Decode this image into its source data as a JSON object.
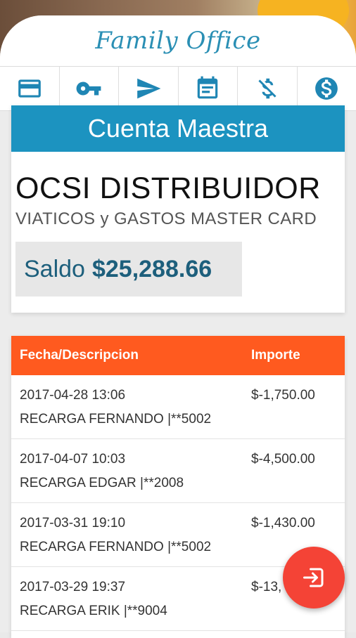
{
  "app": {
    "brand": "Family Office"
  },
  "tabs": [
    {
      "icon": "credit-card-icon",
      "active": false
    },
    {
      "icon": "key-icon",
      "active": true
    },
    {
      "icon": "send-icon",
      "active": false
    },
    {
      "icon": "calendar-icon",
      "active": false
    },
    {
      "icon": "dollar-off-icon",
      "active": false
    },
    {
      "icon": "dollar-circle-icon",
      "active": false
    }
  ],
  "account": {
    "header": "Cuenta Maestra",
    "company": "OCSI DISTRIBUIDOR",
    "description": "VIATICOS y GASTOS MASTER CARD",
    "balance_label": "Saldo",
    "balance_amount": "$25,288.66"
  },
  "transactions": {
    "headers": {
      "date_desc": "Fecha/Descripcion",
      "amount": "Importe"
    },
    "rows": [
      {
        "date": "2017-04-28 13:06",
        "description": "RECARGA FERNANDO |**5002",
        "amount": "$-1,750.00"
      },
      {
        "date": "2017-04-07 10:03",
        "description": "RECARGA EDGAR |**2008",
        "amount": "$-4,500.00"
      },
      {
        "date": "2017-03-31 19:10",
        "description": "RECARGA FERNANDO |**5002",
        "amount": "$-1,430.00"
      },
      {
        "date": "2017-03-29 19:37",
        "description": "RECARGA ERIK |**9004",
        "amount": "$-13,"
      }
    ]
  },
  "fab": {
    "icon": "logout-icon"
  },
  "colors": {
    "accent_blue": "#1c93c0",
    "header_orange": "#ff5a1f",
    "fab_red": "#f44336",
    "tab_active": "#22b07a"
  }
}
